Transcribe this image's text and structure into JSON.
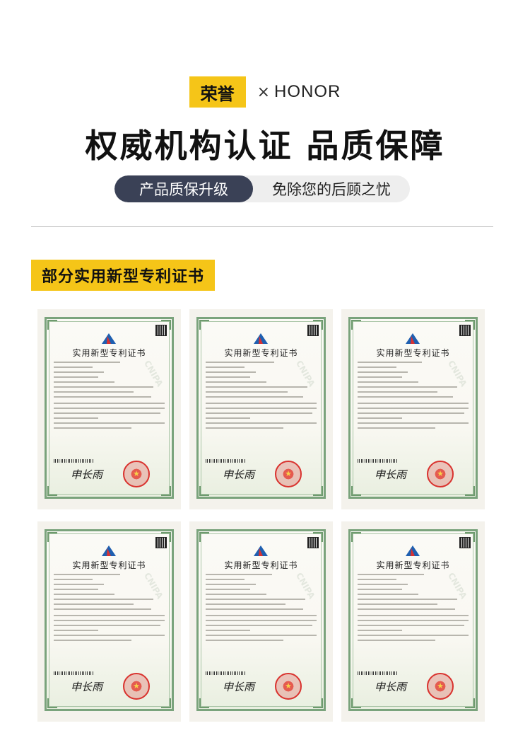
{
  "header": {
    "badge": "荣誉",
    "times": "×",
    "brand": "HONOR",
    "headline": "权威机构认证 品质保障",
    "pill_left": "产品质保升级",
    "pill_right": "免除您的后顾之忧"
  },
  "section": {
    "label": "部分实用新型专利证书"
  },
  "certificates": [
    {
      "title": "实用新型专利证书",
      "signature": "申长雨"
    },
    {
      "title": "实用新型专利证书",
      "signature": "申长雨"
    },
    {
      "title": "实用新型专利证书",
      "signature": "申长雨"
    },
    {
      "title": "实用新型专利证书",
      "signature": "申长雨"
    },
    {
      "title": "实用新型专利证书",
      "signature": "申长雨"
    },
    {
      "title": "实用新型专利证书",
      "signature": "申长雨"
    }
  ],
  "colors": {
    "accent": "#f5c518",
    "pill_dark": "#3a4156",
    "cert_border": "#7aa37c",
    "seal": "#d9322e"
  }
}
